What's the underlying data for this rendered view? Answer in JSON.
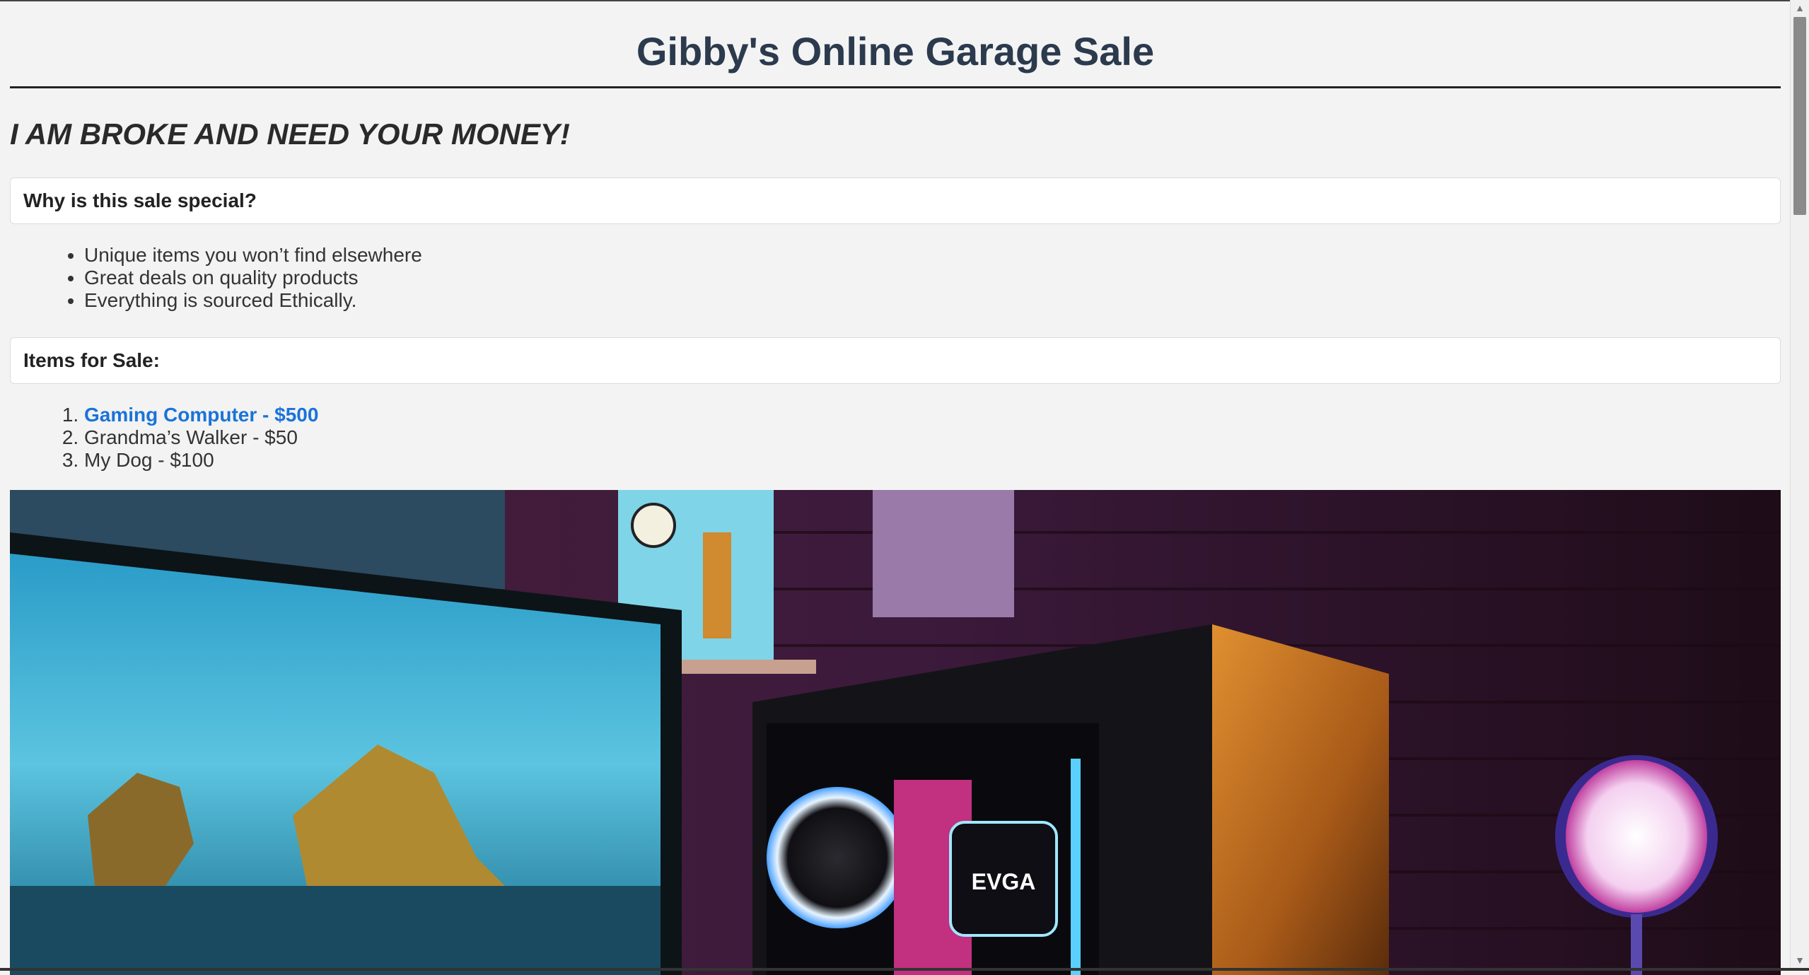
{
  "header": {
    "title": "Gibby's Online Garage Sale"
  },
  "tagline": "I AM BROKE AND NEED YOUR MONEY!",
  "why_section": {
    "heading": "Why is this sale special?",
    "points": [
      "Unique items you won’t find elsewhere",
      "Great deals on quality products",
      "Everything is sourced Ethically."
    ]
  },
  "items_section": {
    "heading": "Items for Sale:",
    "items": [
      "Gaming Computer - $500",
      "Grandma’s Walker - $50",
      "My Dog - $100"
    ]
  },
  "photo": {
    "brand_text": "EVGA"
  },
  "colors": {
    "title": "#2b3a4d",
    "link": "#1a73d9",
    "background": "#f3f3f3"
  }
}
